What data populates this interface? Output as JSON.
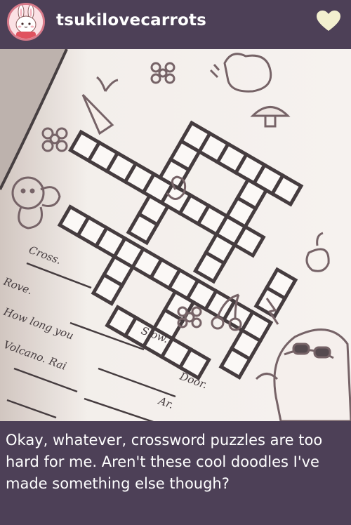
{
  "post": {
    "username": "tsukilovecarrots",
    "caption": "Okay, whatever, crossword puzzles are too hard for me. Aren't these cool doodles I've made something else though?"
  },
  "photo": {
    "handwriting": [
      "Cross.",
      "Rove.",
      "Slow.",
      "How long you",
      "Volcano. Rai",
      "Door.",
      "Ar."
    ]
  },
  "icons": {
    "avatar": "bunny-avatar-icon",
    "like": "heart-icon"
  },
  "colors": {
    "background": "#4d4057",
    "text": "#ffffff",
    "heart": "#f2efcf",
    "avatar_ring": "#d87a8a"
  }
}
